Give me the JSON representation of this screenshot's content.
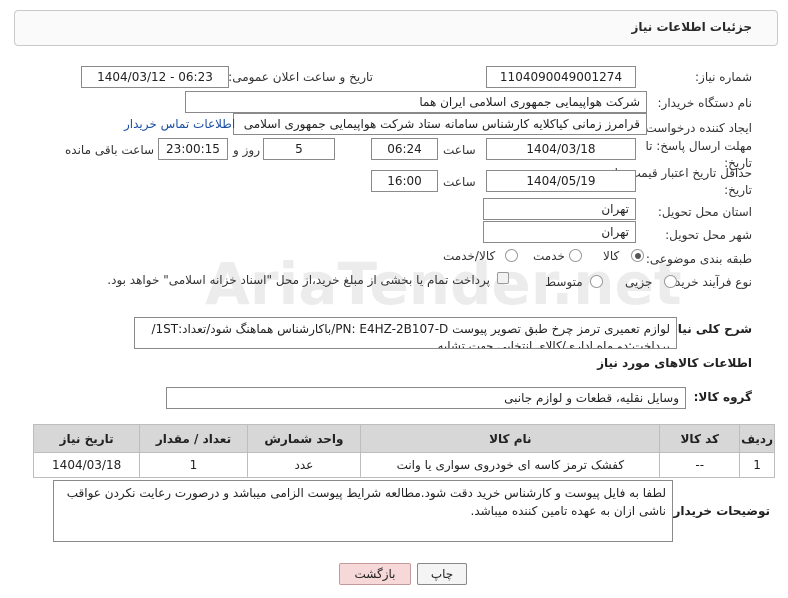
{
  "header": {
    "title": "جزئیات اطلاعات نیاز"
  },
  "watermark": {
    "text": "AriaTender.net"
  },
  "form": {
    "need_number": {
      "label": "شماره نیاز:",
      "value": "1104090049001274"
    },
    "announce_datetime": {
      "label": "تاریخ و ساعت اعلان عمومی:",
      "value": "1404/03/12 - 06:23"
    },
    "buyer_org": {
      "label": "نام دستگاه خریدار:",
      "value": "شرکت هواپیمایی جمهوری اسلامی ایران هما"
    },
    "requester": {
      "label": "ایجاد کننده درخواست:",
      "value": "قرامرز زمانی کیاکلایه کارشناس سامانه ستاد شرکت هواپیمایی جمهوری اسلامی",
      "contact_link": "اطلاعات تماس خریدار"
    },
    "reply_deadline": {
      "label": "مهلت ارسال پاسخ: تا تاریخ:",
      "date": "1404/03/18",
      "time_label": "ساعت",
      "time": "06:24",
      "days": "5",
      "days_label": "روز و",
      "remaining": "23:00:15",
      "remaining_label": "ساعت باقی مانده"
    },
    "price_validity": {
      "label": "حداقل تاریخ اعتبار قیمت: تا تاریخ:",
      "date": "1404/05/19",
      "time_label": "ساعت",
      "time": "16:00"
    },
    "province": {
      "label": "استان محل تحویل:",
      "value": "تهران"
    },
    "city": {
      "label": "شهر محل تحویل:",
      "value": "تهران"
    },
    "category": {
      "label": "طبقه بندی موضوعی:",
      "options": [
        "کالا",
        "خدمت",
        "کالا/خدمت"
      ],
      "selected": "کالا"
    },
    "process_type": {
      "label": "نوع فرآیند خرید :",
      "options": [
        "جزیی",
        "متوسط"
      ],
      "selected": "جزیی",
      "payment_note": "پرداخت تمام یا بخشی از مبلغ خرید،از محل \"اسناد خزانه اسلامی\" خواهد بود."
    },
    "description": {
      "label": "شرح کلی نیاز:",
      "line1": "لوازم تعمیری ترمز چرخ طبق تصویر پیوست PN: E4HZ-2B107-D/باکارشناس هماهنگ شود/تعداد:1ST/",
      "line2": "پرداخت:دو ماه اداری/کالای انتخابی جهت تشابه"
    }
  },
  "goods_section": {
    "title": "اطلاعات کالاهای مورد نیاز",
    "group_label": "گروه کالا:",
    "group_value": "وسایل نقلیه، قطعات و لوازم جانبی",
    "columns": [
      "ردیف",
      "کد کالا",
      "نام کالا",
      "واحد شمارش",
      "تعداد / مقدار",
      "تاریخ نیاز"
    ],
    "rows": [
      {
        "index": "1",
        "code": "--",
        "name": "کفشک ترمز کاسه ای خودروی سواری یا وانت",
        "unit": "عدد",
        "qty": "1",
        "date": "1404/03/18"
      }
    ]
  },
  "buyer_notes": {
    "label": "توضیحات خریدار:",
    "text": "لطفا به فایل پیوست و کارشناس خرید دقت شود.مطالعه شرایط پیوست الزامی میباشد و درصورت رعایت نکردن عواقب ناشی ازان به عهده تامین کننده میباشد."
  },
  "buttons": {
    "print": "چاپ",
    "back": "بازگشت"
  }
}
